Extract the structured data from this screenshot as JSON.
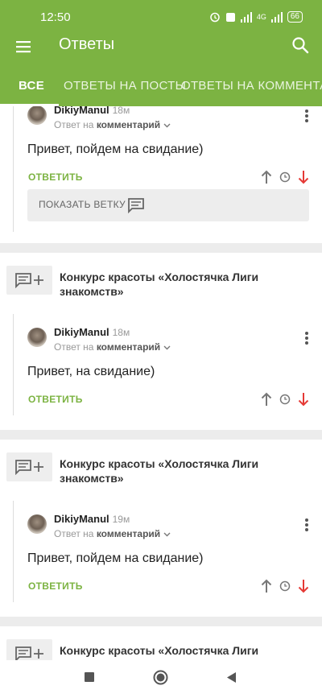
{
  "status": {
    "time": "12:50",
    "network": "4G",
    "battery": "66"
  },
  "toolbar": {
    "title": "Ответы"
  },
  "tabs": [
    {
      "label": "ВСЕ"
    },
    {
      "label": "ОТВЕТЫ НА ПОСТЫ"
    },
    {
      "label": "ОТВЕТЫ НА КОММЕНТАРИИ"
    }
  ],
  "cards": [
    {
      "comment": {
        "author": "DikiyManul",
        "ago": "18м",
        "reply_prefix": "Ответ на",
        "reply_target": "комментарий",
        "text": "Привет, пойдем на свидание)",
        "reply_label": "ОТВЕТИТЬ"
      },
      "show_thread_label": "ПОКАЗАТЬ ВЕТКУ"
    },
    {
      "post_title": "Конкурс красоты «Холостячка Лиги знакомств»",
      "comment": {
        "author": "DikiyManul",
        "ago": "18м",
        "reply_prefix": "Ответ на",
        "reply_target": "комментарий",
        "text": "Привет, на свидание)",
        "reply_label": "ОТВЕТИТЬ"
      }
    },
    {
      "post_title": "Конкурс красоты «Холостячка Лиги знакомств»",
      "comment": {
        "author": "DikiyManul",
        "ago": "19м",
        "reply_prefix": "Ответ на",
        "reply_target": "комментарий",
        "text": "Привет, пойдем на свидание)",
        "reply_label": "ОТВЕТИТЬ"
      }
    },
    {
      "post_title": "Конкурс красоты «Холостячка Лиги"
    }
  ],
  "colors": {
    "accent": "#7cb342",
    "downvote": "#e53935"
  }
}
